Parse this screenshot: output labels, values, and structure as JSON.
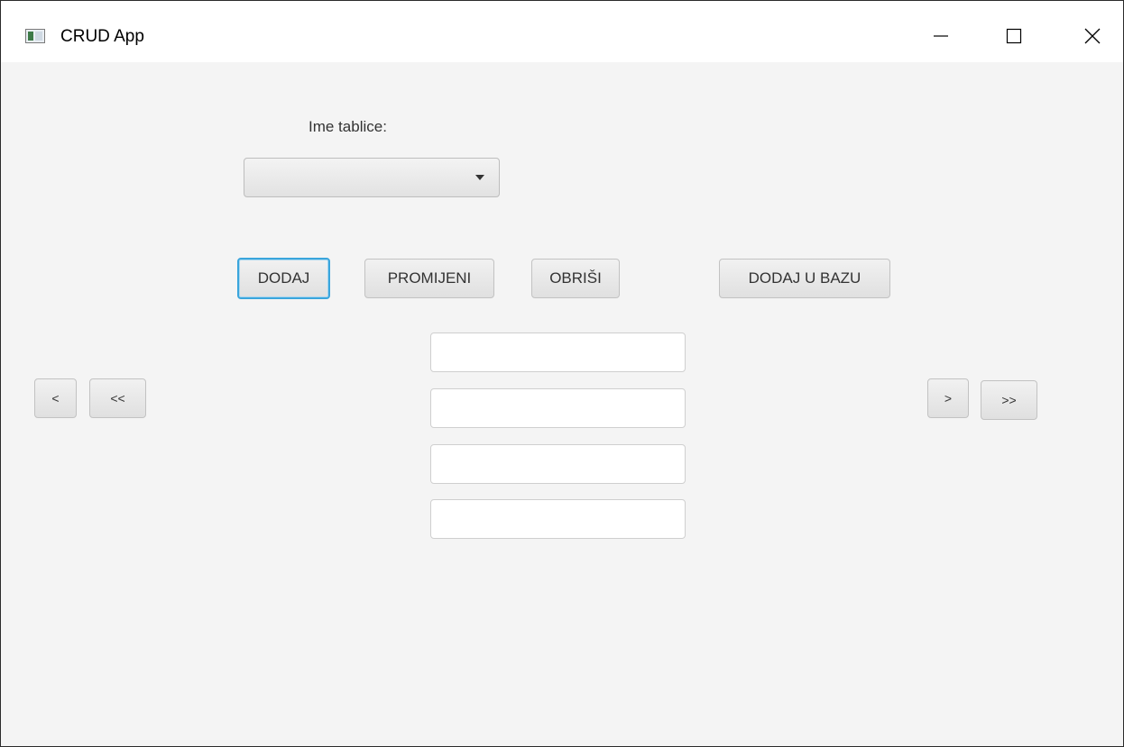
{
  "window": {
    "title": "CRUD App",
    "minimize_symbol": "minimize-icon",
    "maximize_symbol": "maximize-icon",
    "close_symbol": "close-icon"
  },
  "table_selector": {
    "label": "Ime tablice:",
    "selected_value": ""
  },
  "actions": {
    "add": "DODAJ",
    "change": "PROMIJENI",
    "delete": "OBRIŠI",
    "add_to_db": "DODAJ U BAZU"
  },
  "navigation": {
    "prev": "<",
    "first": "<<",
    "next": ">",
    "last": ">>"
  },
  "fields": [
    {
      "value": ""
    },
    {
      "value": ""
    },
    {
      "value": ""
    },
    {
      "value": ""
    }
  ],
  "colors": {
    "background": "#f4f4f4",
    "focus_accent": "#3aa5dc"
  }
}
